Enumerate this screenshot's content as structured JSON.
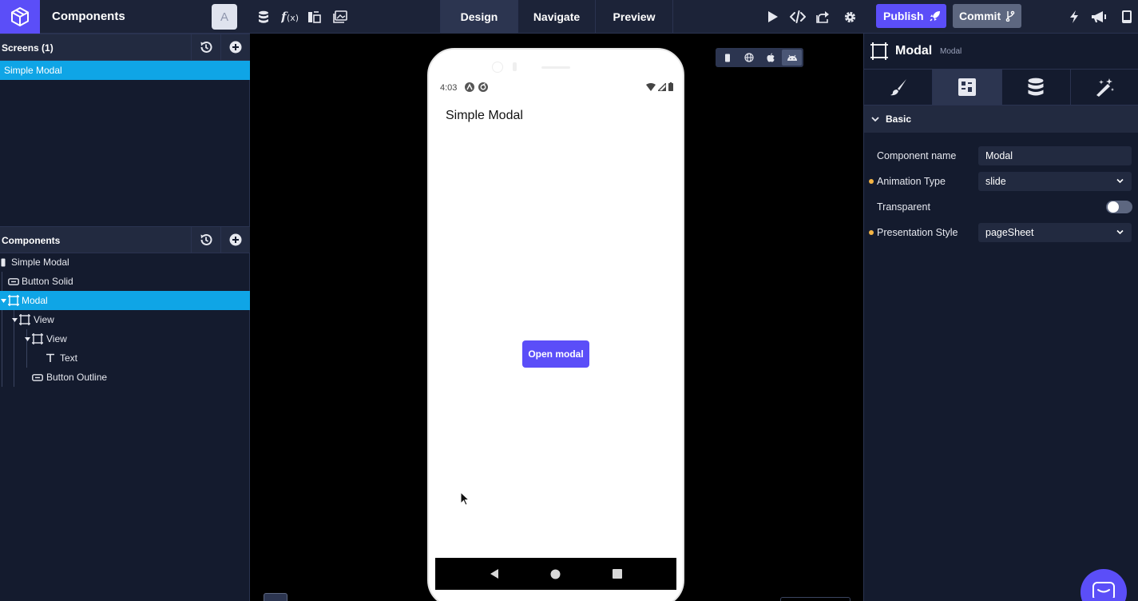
{
  "app": {
    "title": "Components",
    "avatar_letter": "A",
    "brand_color": "#5b4ef8",
    "select_color": "#0fa5e6"
  },
  "toolbar": {
    "left_icons": [
      "database-icon",
      "function-icon",
      "assets-icon",
      "image-icon"
    ],
    "tabs": [
      {
        "label": "Design",
        "active": true
      },
      {
        "label": "Navigate",
        "active": false
      },
      {
        "label": "Preview",
        "active": false
      }
    ],
    "right_icons": [
      "play-icon",
      "code-icon",
      "share-icon",
      "gear-icon"
    ],
    "publish_label": "Publish",
    "commit_label": "Commit",
    "far_right_icons": [
      "bolt-icon",
      "megaphone-icon",
      "phone-icon"
    ]
  },
  "screens": {
    "header": "Screens (1)",
    "items": [
      {
        "label": "Simple Modal",
        "selected": true
      }
    ]
  },
  "components": {
    "header": "Components",
    "tree": [
      {
        "label": "Simple Modal",
        "icon": "screen-icon",
        "depth": 0,
        "caret": false,
        "selected": false
      },
      {
        "label": "Button Solid",
        "icon": "button-icon",
        "depth": 1,
        "caret": false,
        "selected": false
      },
      {
        "label": "Modal",
        "icon": "frame-icon",
        "depth": 1,
        "caret": true,
        "selected": true
      },
      {
        "label": "View",
        "icon": "frame-icon",
        "depth": 2,
        "caret": true,
        "selected": false
      },
      {
        "label": "View",
        "icon": "frame-icon",
        "depth": 3,
        "caret": true,
        "selected": false
      },
      {
        "label": "Text",
        "icon": "text-icon",
        "depth": 4,
        "caret": false,
        "selected": false
      },
      {
        "label": "Button Outline",
        "icon": "button-icon",
        "depth": 3,
        "caret": false,
        "selected": false
      }
    ]
  },
  "canvas": {
    "device_modes": [
      {
        "icon": "mobile-icon",
        "active": false
      },
      {
        "icon": "globe-icon",
        "active": false
      },
      {
        "icon": "apple-icon",
        "active": false
      },
      {
        "icon": "android-icon",
        "active": true
      }
    ],
    "phone": {
      "status_time": "4:03",
      "screen_title": "Simple Modal",
      "button_label": "Open modal"
    }
  },
  "inspector": {
    "component_title": "Modal",
    "component_type": "Modal",
    "tabs": [
      "brush-icon",
      "properties-icon",
      "data-icon",
      "magic-wand-icon"
    ],
    "active_tab": 1,
    "section": "Basic",
    "properties": [
      {
        "label": "Component name",
        "value": "Modal",
        "kind": "text",
        "modified": false
      },
      {
        "label": "Animation Type",
        "value": "slide",
        "kind": "select",
        "modified": true
      },
      {
        "label": "Transparent",
        "value": "",
        "kind": "toggle",
        "modified": false,
        "on": false
      },
      {
        "label": "Presentation Style",
        "value": "pageSheet",
        "kind": "select",
        "modified": true
      }
    ]
  }
}
